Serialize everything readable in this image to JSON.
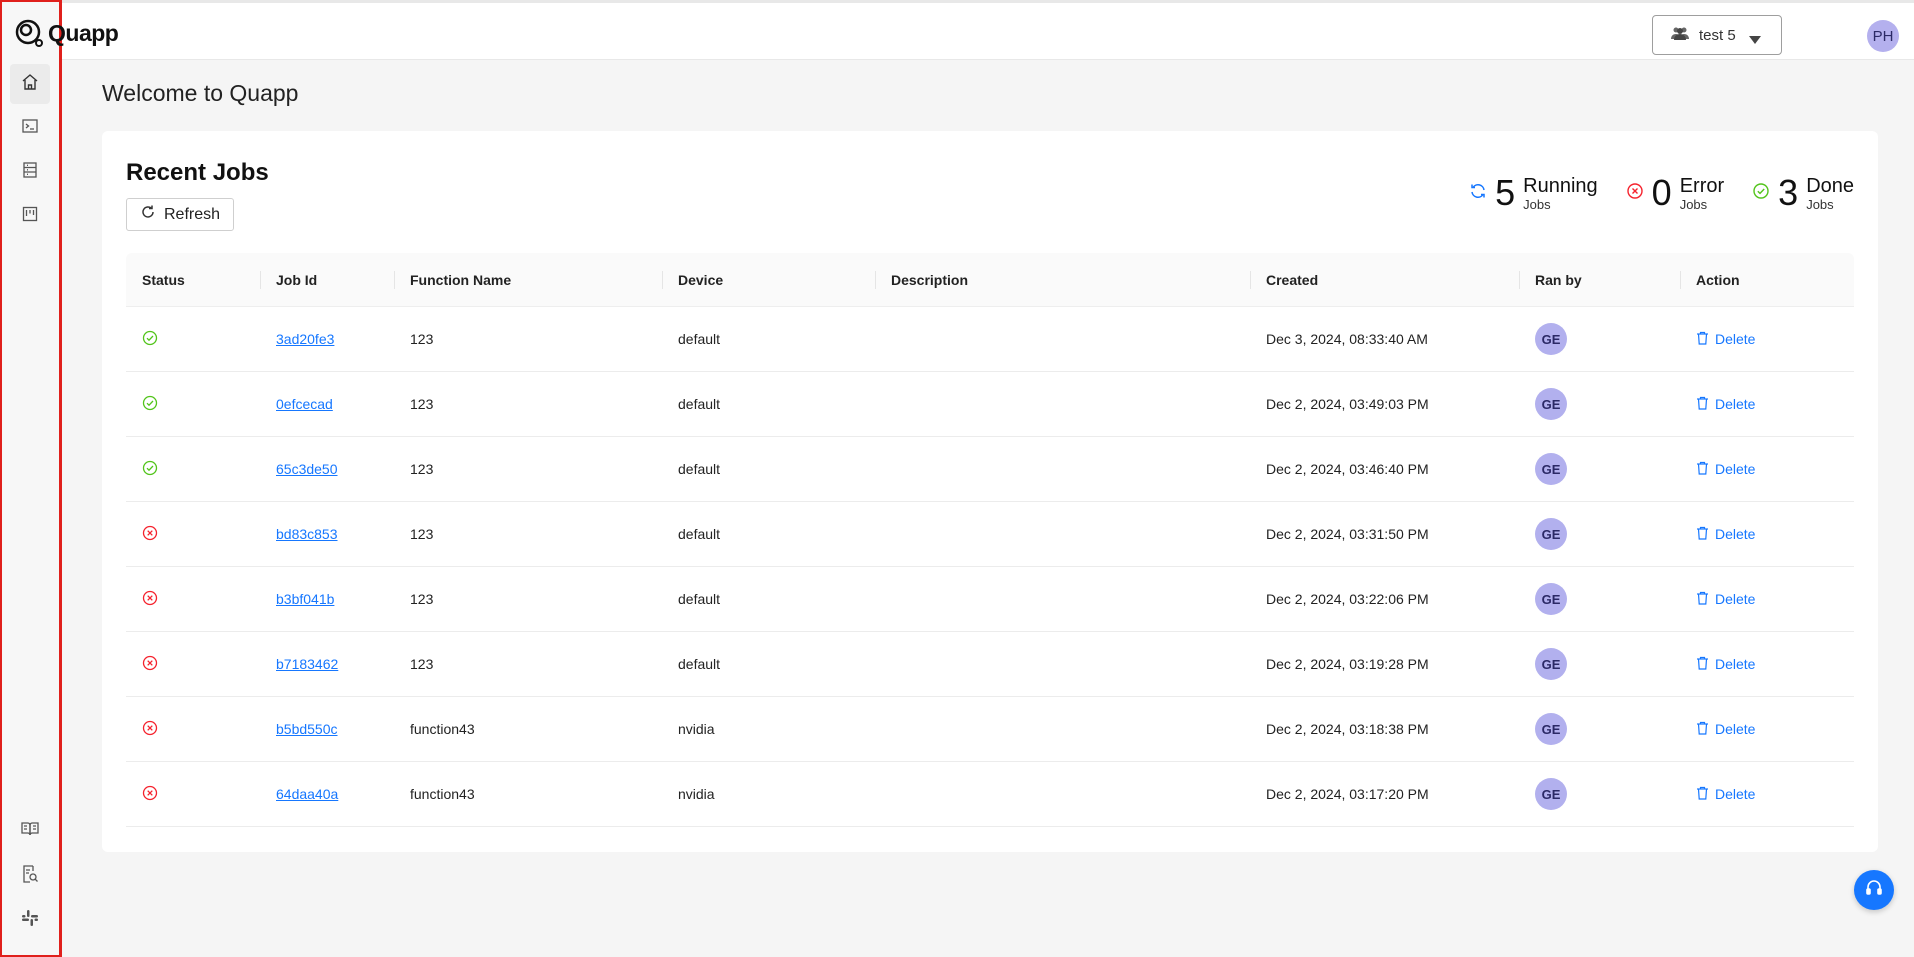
{
  "app": {
    "name": "Quapp"
  },
  "header": {
    "workspace": "test 5",
    "user_initials": "PH"
  },
  "page": {
    "title": "Welcome to Quapp"
  },
  "sidebar": {
    "top_items": [
      {
        "icon": "home-icon",
        "active": true
      },
      {
        "icon": "terminal-icon",
        "active": false
      },
      {
        "icon": "database-icon",
        "active": false
      },
      {
        "icon": "board-icon",
        "active": false
      }
    ],
    "bottom_items": [
      {
        "icon": "book-icon"
      },
      {
        "icon": "document-search-icon"
      },
      {
        "icon": "slack-icon"
      }
    ]
  },
  "recent_jobs": {
    "title": "Recent Jobs",
    "refresh_label": "Refresh",
    "stats": {
      "running": {
        "count": "5",
        "label": "Running",
        "sub": "Jobs"
      },
      "error": {
        "count": "0",
        "label": "Error",
        "sub": "Jobs"
      },
      "done": {
        "count": "3",
        "label": "Done",
        "sub": "Jobs"
      }
    },
    "columns": [
      "Status",
      "Job Id",
      "Function Name",
      "Device",
      "Description",
      "Created",
      "Ran by",
      "Action"
    ],
    "delete_label": "Delete",
    "rows": [
      {
        "status": "done",
        "job_id": "3ad20fe3",
        "function": "123",
        "device": "default",
        "description": "",
        "created": "Dec 3, 2024, 08:33:40 AM",
        "ran_by": "GE"
      },
      {
        "status": "done",
        "job_id": "0efcecad",
        "function": "123",
        "device": "default",
        "description": "",
        "created": "Dec 2, 2024, 03:49:03 PM",
        "ran_by": "GE"
      },
      {
        "status": "done",
        "job_id": "65c3de50",
        "function": "123",
        "device": "default",
        "description": "",
        "created": "Dec 2, 2024, 03:46:40 PM",
        "ran_by": "GE"
      },
      {
        "status": "error",
        "job_id": "bd83c853",
        "function": "123",
        "device": "default",
        "description": "",
        "created": "Dec 2, 2024, 03:31:50 PM",
        "ran_by": "GE"
      },
      {
        "status": "error",
        "job_id": "b3bf041b",
        "function": "123",
        "device": "default",
        "description": "",
        "created": "Dec 2, 2024, 03:22:06 PM",
        "ran_by": "GE"
      },
      {
        "status": "error",
        "job_id": "b7183462",
        "function": "123",
        "device": "default",
        "description": "",
        "created": "Dec 2, 2024, 03:19:28 PM",
        "ran_by": "GE"
      },
      {
        "status": "error",
        "job_id": "b5bd550c",
        "function": "function43",
        "device": "nvidia",
        "description": "",
        "created": "Dec 2, 2024, 03:18:38 PM",
        "ran_by": "GE"
      },
      {
        "status": "error",
        "job_id": "64daa40a",
        "function": "function43",
        "device": "nvidia",
        "description": "",
        "created": "Dec 2, 2024, 03:17:20 PM",
        "ran_by": "GE"
      }
    ]
  },
  "colors": {
    "accent": "#1677ff",
    "done": "#52c41a",
    "error": "#f5222d",
    "avatar": "#b2b0ee",
    "sidebar_border": "#e0201c"
  }
}
